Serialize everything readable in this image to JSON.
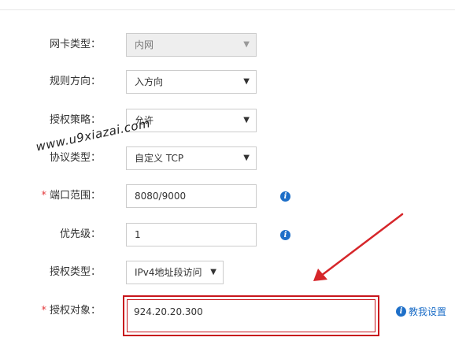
{
  "form": {
    "nic_type": {
      "label": "网卡类型：",
      "value": "内网",
      "disabled": true
    },
    "direction": {
      "label": "规则方向：",
      "value": "入方向"
    },
    "policy": {
      "label": "授权策略：",
      "value": "允许"
    },
    "protocol": {
      "label": "协议类型：",
      "value": "自定义 TCP"
    },
    "port_range": {
      "required_mark": "*",
      "label": "端口范围：",
      "value": "8080/9000"
    },
    "priority": {
      "label": "优先级：",
      "value": "1"
    },
    "auth_type": {
      "label": "授权类型：",
      "value": "IPv4地址段访问"
    },
    "auth_target": {
      "required_mark": "*",
      "label": "授权对象：",
      "value": "924.20.20.300"
    }
  },
  "help_link": {
    "label": "教我设置"
  },
  "watermark": {
    "text": "www.u9xiazai.com"
  },
  "colors": {
    "accent_blue": "#1e6fc8",
    "highlight_red": "#c8161d",
    "required_red": "#e4393c"
  },
  "icons": {
    "dropdown": "caret-down-icon",
    "info": "info-icon"
  }
}
